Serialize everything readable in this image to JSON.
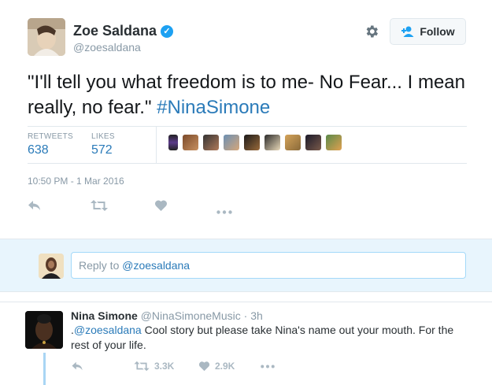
{
  "tweet": {
    "author_name": "Zoe Saldana",
    "author_handle": "@zoesaldana",
    "follow_label": "Follow",
    "text_before": "\"I'll tell you what freedom is to me- No Fear... I mean really, no fear.\"",
    "hashtag": "#NinaSimone",
    "retweets_label": "RETWEETS",
    "retweets_value": "638",
    "likes_label": "LIKES",
    "likes_value": "572",
    "timestamp": "10:50 PM - 1 Mar 2016"
  },
  "reply_box": {
    "prefix": "Reply to ",
    "mention": "@zoesaldana"
  },
  "reply": {
    "author_name": "Nina Simone",
    "author_handle": "@NinaSimoneMusic",
    "separator": " · ",
    "time": "3h",
    "text_prefix": ".",
    "mention": "@zoesaldana",
    "text": " Cool story but please take Nina's name out your mouth. For the rest of your life.",
    "retweet_count": "3.3K",
    "like_count": "2.9K"
  },
  "icons": {
    "verified": "verified-badge-icon",
    "gear": "gear-icon",
    "follow": "add-user-icon",
    "reply": "reply-icon",
    "retweet": "retweet-icon",
    "like": "heart-icon",
    "more": "more-icon"
  },
  "colors": {
    "accent": "#1da1f2",
    "link": "#2b7bb9",
    "muted": "#8899a6",
    "action": "#aab8c2",
    "reply_area_bg": "#e8f5fd"
  }
}
